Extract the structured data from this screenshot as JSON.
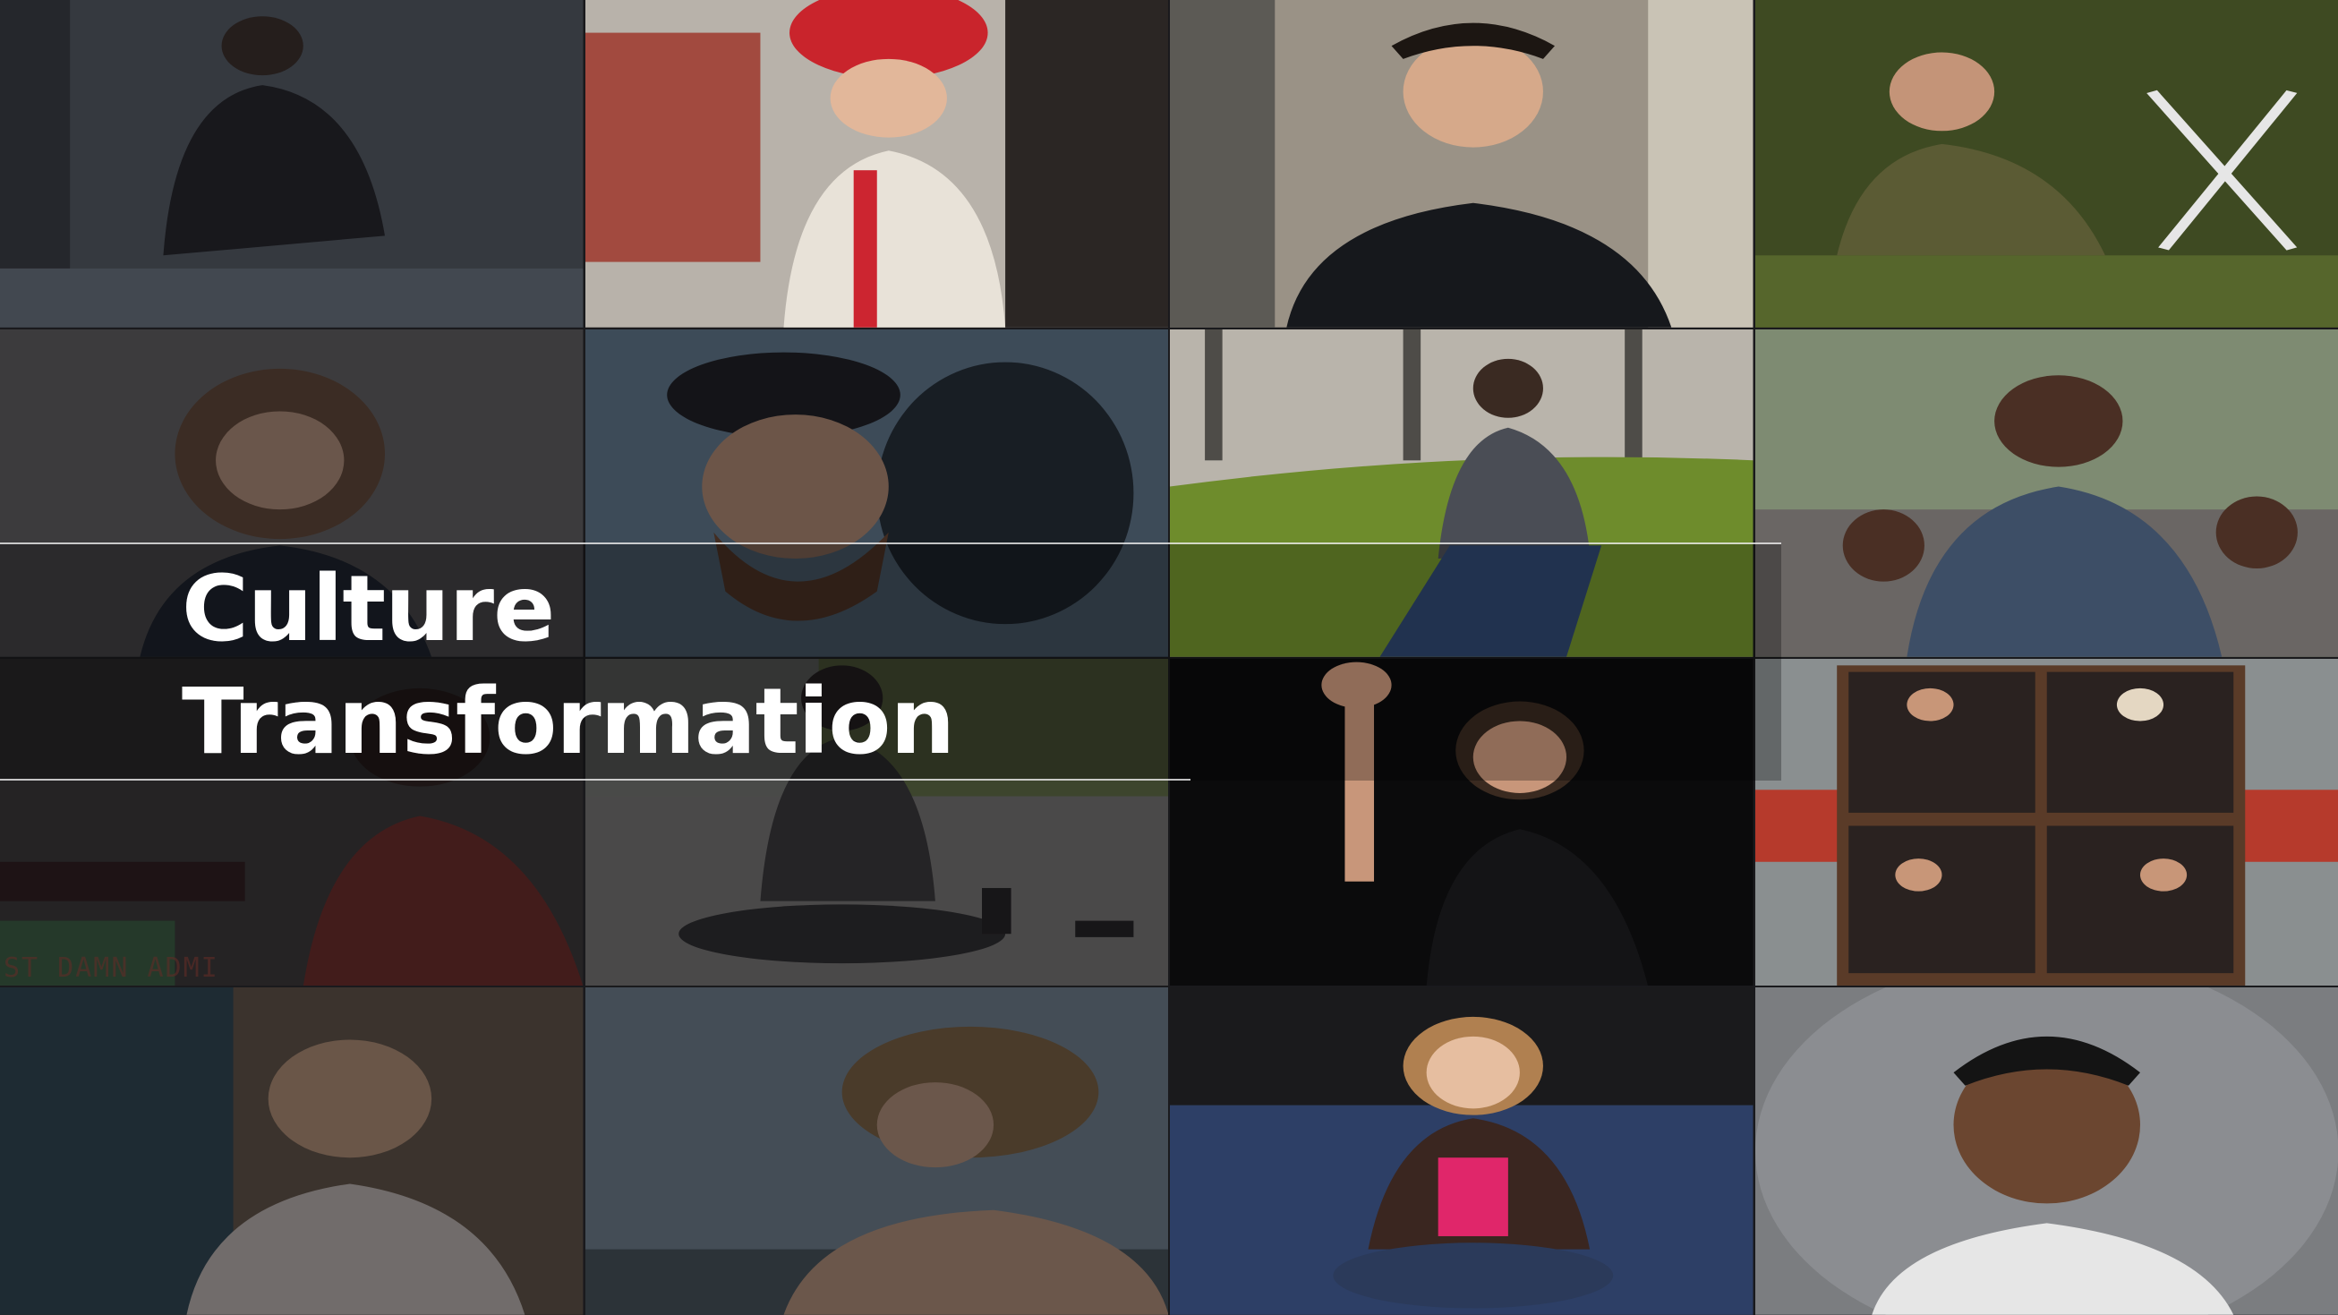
{
  "slide": {
    "title_line1": "Culture",
    "title_line2": "Transformation"
  },
  "tiles": [
    {
      "subject": "man-at-table-photo",
      "dimmed": true
    },
    {
      "subject": "woman-red-hat-photo",
      "dimmed": false
    },
    {
      "subject": "man-corridor-portrait-photo",
      "dimmed": false
    },
    {
      "subject": "man-with-shears-photo",
      "dimmed": false
    },
    {
      "subject": "smiling-woman-photo",
      "dimmed": true
    },
    {
      "subject": "man-in-cap-photo",
      "dimmed": true
    },
    {
      "subject": "woman-sitting-on-grass-photo",
      "dimmed": false
    },
    {
      "subject": "woman-denim-jacket-photo",
      "dimmed": false
    },
    {
      "subject": "woman-in-sari-photo",
      "dimmed": true
    },
    {
      "subject": "woman-sitting-on-road-photo",
      "dimmed": true
    },
    {
      "subject": "woman-raising-hand-photo",
      "dimmed": false
    },
    {
      "subject": "people-in-boxes-photo",
      "dimmed": false
    },
    {
      "subject": "older-man-portrait-photo",
      "dimmed": true
    },
    {
      "subject": "woman-with-glasses-photo",
      "dimmed": true
    },
    {
      "subject": "woman-on-sofa-photo",
      "dimmed": false
    },
    {
      "subject": "man-dark-background-photo",
      "dimmed": false
    }
  ],
  "background_text": "ST DAMN ADMI"
}
